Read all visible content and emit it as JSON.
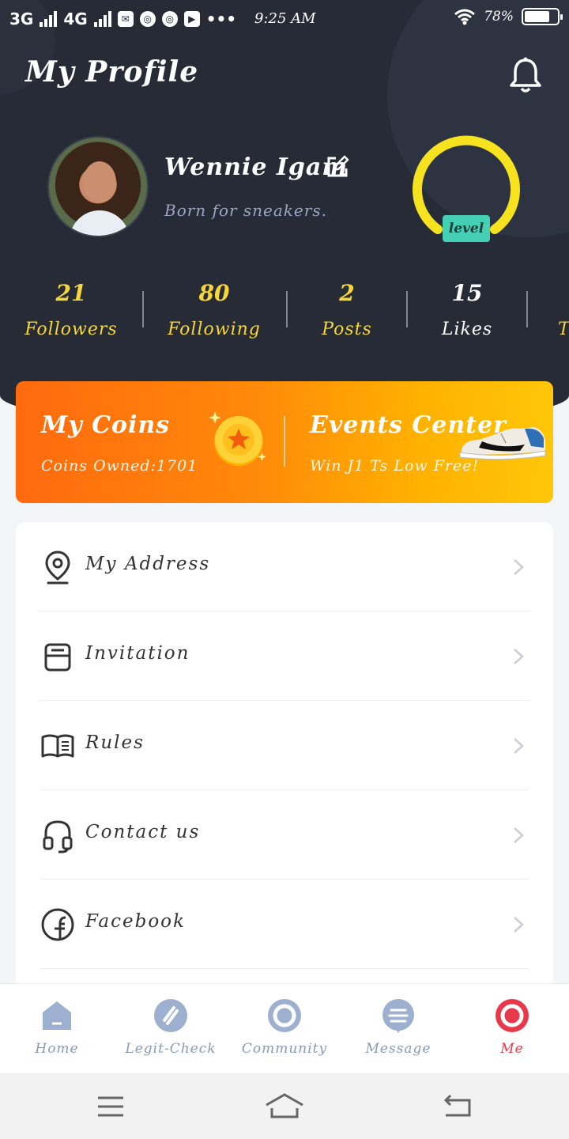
{
  "status_bar": {
    "network1": "3G",
    "network2": "4G",
    "app_icons": [
      "mail-icon",
      "chrome-icon",
      "chrome-icon",
      "youtube-icon"
    ],
    "more": "•••",
    "time": "9:25 AM",
    "battery": "78%",
    "battery_level": 0.78
  },
  "header": {
    "title": "My Profile"
  },
  "profile": {
    "name": "Wennie Igam",
    "bio": "Born for sneakers.",
    "level_label": "level",
    "level_color": "#f6e21f"
  },
  "stats": [
    {
      "value": "21",
      "label": "Followers"
    },
    {
      "value": "80",
      "label": "Following"
    },
    {
      "value": "2",
      "label": "Posts"
    },
    {
      "value": "15",
      "label": "Likes"
    }
  ],
  "stats_next_label_fragment": "T",
  "coins_banner": {
    "coins_title": "My Coins",
    "coins_owned": "Coins Owned:1701",
    "events_title": "Events Center",
    "events_sub": "Win J1 Ts Low Free!"
  },
  "menu": [
    {
      "label": "My Address",
      "icon": "location-pin-icon"
    },
    {
      "label": "Invitation",
      "icon": "invitation-icon"
    },
    {
      "label": "Rules",
      "icon": "book-icon"
    },
    {
      "label": "Contact us",
      "icon": "headset-icon"
    },
    {
      "label": "Facebook",
      "icon": "facebook-icon"
    }
  ],
  "tabs": [
    {
      "label": "Home",
      "icon": "home-icon"
    },
    {
      "label": "Legit-Check",
      "icon": "legit-check-icon"
    },
    {
      "label": "Community",
      "icon": "community-icon"
    },
    {
      "label": "Message",
      "icon": "message-icon"
    },
    {
      "label": "Me",
      "icon": "me-icon",
      "active": true
    }
  ],
  "colors": {
    "header_bg": "#262b36",
    "accent_yellow": "#f6d63a",
    "active_tab": "#e8394b",
    "inactive_tab": "#8b98b6",
    "level_badge": "#45d0b6"
  }
}
